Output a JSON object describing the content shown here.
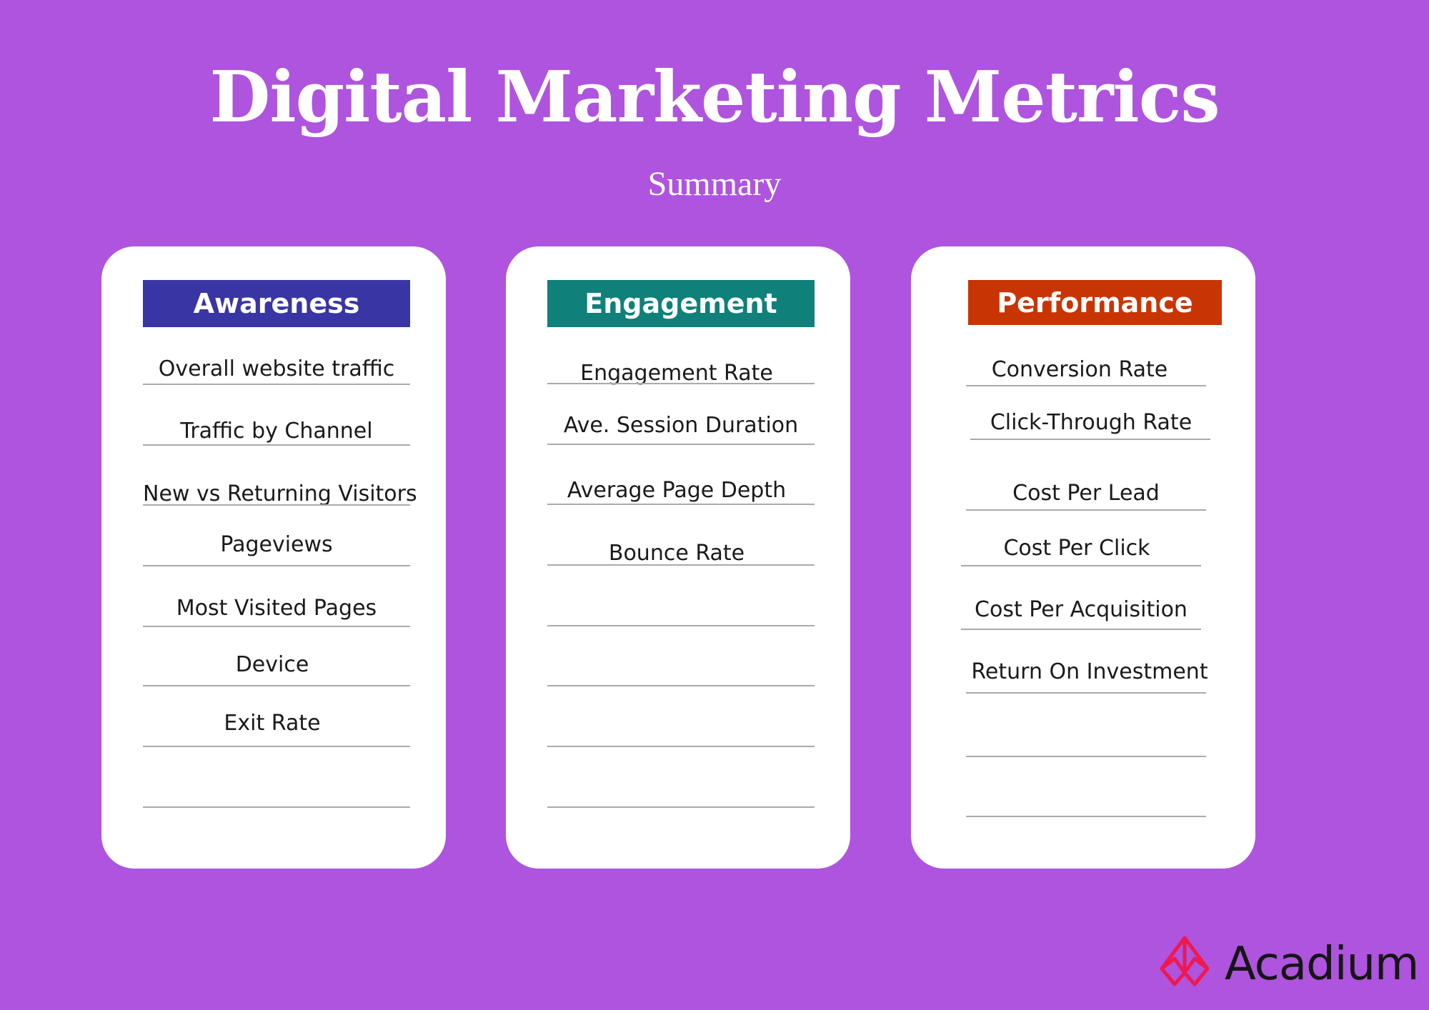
{
  "header": {
    "title": "Digital Marketing Metrics",
    "subtitle": "Summary"
  },
  "cards": [
    {
      "title": "Awareness",
      "color": "#3A35A4",
      "items": [
        "Overall website traffic",
        "Traffic by Channel",
        "New vs Returning Visitors",
        "Pageviews",
        "Most Visited Pages",
        "Device",
        "Exit Rate",
        ""
      ]
    },
    {
      "title": "Engagement",
      "color": "#0F807A",
      "items": [
        "Engagement Rate",
        "Ave. Session Duration",
        "Average Page Depth",
        "Bounce Rate",
        "",
        "",
        "",
        ""
      ]
    },
    {
      "title": "Performance",
      "color": "#C83503",
      "items": [
        "Conversion Rate",
        "Click-Through Rate",
        "Cost Per Lead",
        "Cost Per Click",
        "Cost Per Acquisition",
        "Return On Investment",
        "",
        ""
      ]
    }
  ],
  "brand": {
    "name": "Acadium",
    "icon": "acadium-logo-icon",
    "icon_color": "#F0184F"
  }
}
